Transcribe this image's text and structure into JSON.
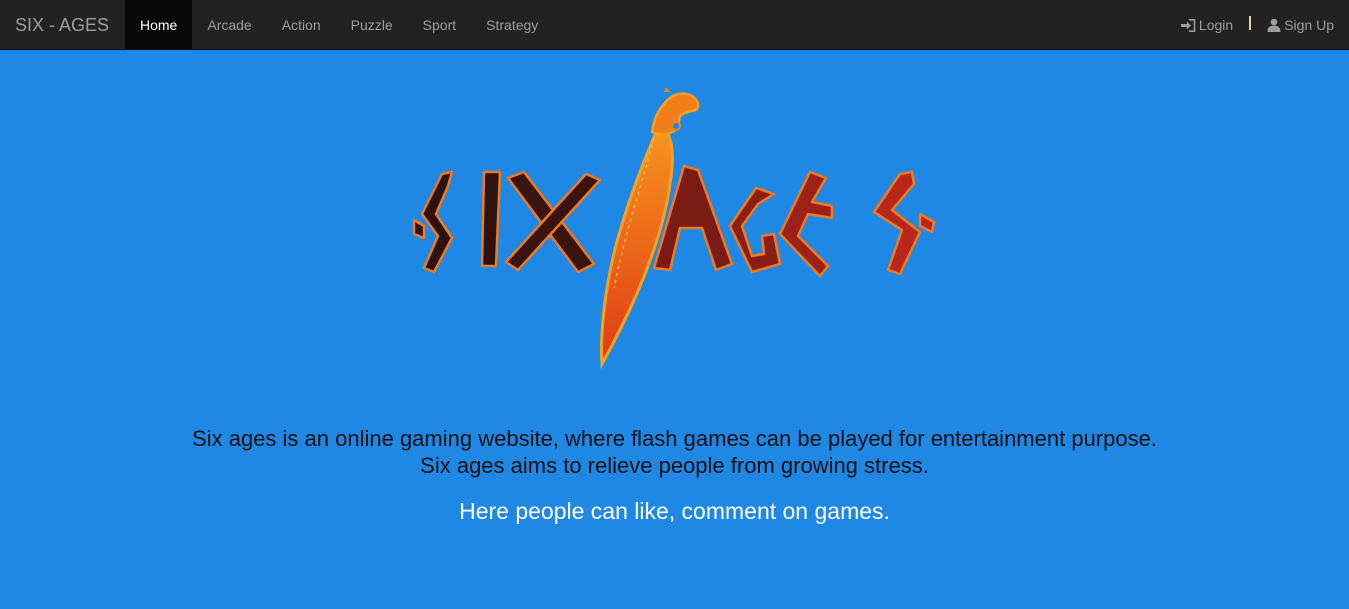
{
  "navbar": {
    "brand": "SIX - AGES",
    "items": [
      {
        "label": "Home",
        "active": true
      },
      {
        "label": "Arcade",
        "active": false
      },
      {
        "label": "Action",
        "active": false
      },
      {
        "label": "Puzzle",
        "active": false
      },
      {
        "label": "Sport",
        "active": false
      },
      {
        "label": "Strategy",
        "active": false
      }
    ],
    "login_label": "Login",
    "login_icon": "login-icon",
    "signup_label": "Sign Up",
    "signup_icon": "user-icon"
  },
  "logo": {
    "text": "SIX AGES",
    "colors": {
      "dark": "#2d1210",
      "mid": "#7a1c15",
      "bright": "#b8271c",
      "outline": "#f07a1e",
      "blade": "#f06a1a"
    }
  },
  "intro": {
    "line1": "Six ages is an online gaming website, where flash games can be played for entertainment purpose.",
    "line2": "Six ages aims to relieve people from growing stress."
  },
  "tagline": "Here people can like, comment on games.",
  "colors": {
    "background": "#1f88e5",
    "navbar": "#222222",
    "active_tab": "#080808"
  }
}
